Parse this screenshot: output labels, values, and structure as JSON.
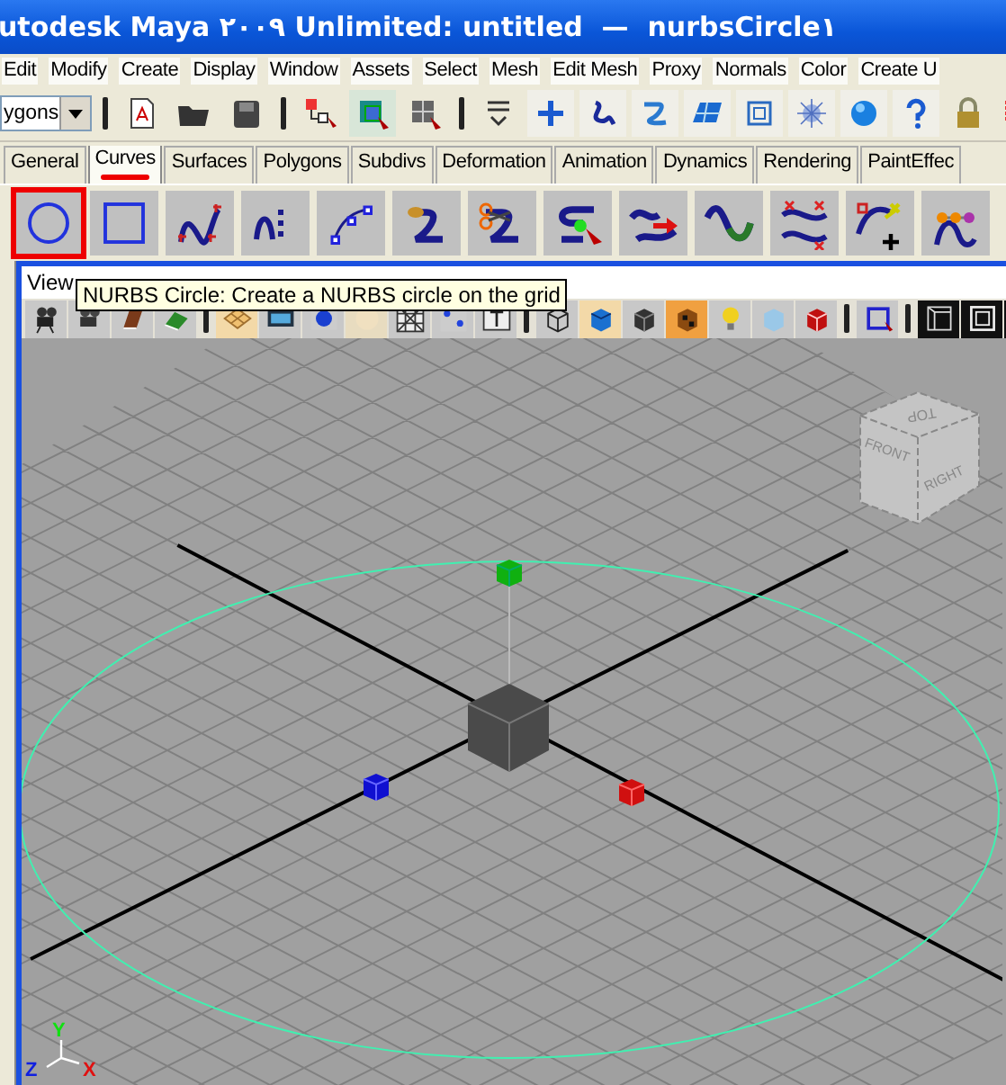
{
  "window": {
    "title": "utodesk Maya ۲۰۰۹ Unlimited: untitled  —  nurbsCircle۱"
  },
  "menu": [
    "Edit",
    "Modify",
    "Create",
    "Display",
    "Window",
    "Assets",
    "Select",
    "Mesh",
    "Edit Mesh",
    "Proxy",
    "Normals",
    "Color",
    "Create U"
  ],
  "status_line": {
    "mode_dropdown": "ygons"
  },
  "shelf_tabs": [
    {
      "label": "General",
      "selected": false
    },
    {
      "label": "Curves",
      "selected": true
    },
    {
      "label": "Surfaces",
      "selected": false
    },
    {
      "label": "Polygons",
      "selected": false
    },
    {
      "label": "Subdivs",
      "selected": false
    },
    {
      "label": "Deformation",
      "selected": false
    },
    {
      "label": "Animation",
      "selected": false
    },
    {
      "label": "Dynamics",
      "selected": false
    },
    {
      "label": "Rendering",
      "selected": false
    },
    {
      "label": "PaintEffec",
      "selected": false
    }
  ],
  "shelf_tools": [
    {
      "highlighted": true
    },
    {
      "highlighted": false
    },
    {
      "highlighted": false
    },
    {
      "highlighted": false
    },
    {
      "highlighted": false
    },
    {
      "highlighted": false
    },
    {
      "highlighted": false
    },
    {
      "highlighted": false
    },
    {
      "highlighted": false
    },
    {
      "highlighted": false
    },
    {
      "highlighted": false
    },
    {
      "highlighted": false
    },
    {
      "highlighted": false
    }
  ],
  "panel": {
    "menu": [
      "View"
    ],
    "tooltip": "NURBS Circle: Create a NURBS circle on the grid"
  },
  "viewport": {
    "view_cube": {
      "top": "TOP",
      "front": "FRONT",
      "right": "RIGHT"
    },
    "axis_indicator": {
      "y": "Y",
      "z": "Z",
      "x": "X"
    }
  }
}
